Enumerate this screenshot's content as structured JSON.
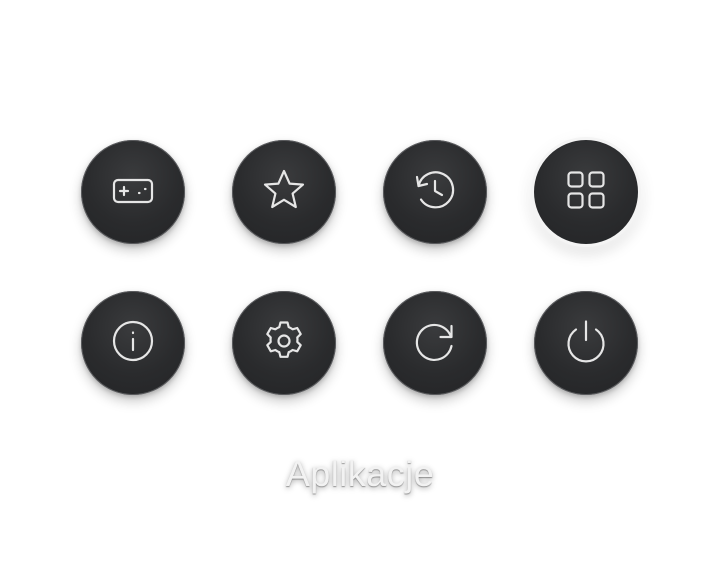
{
  "menu": {
    "items": [
      {
        "id": "games",
        "icon": "gamepad-icon"
      },
      {
        "id": "favorites",
        "icon": "star-icon"
      },
      {
        "id": "history",
        "icon": "history-icon"
      },
      {
        "id": "apps",
        "icon": "apps-grid-icon",
        "selected": true
      },
      {
        "id": "info",
        "icon": "info-icon"
      },
      {
        "id": "settings",
        "icon": "gear-icon"
      },
      {
        "id": "restart",
        "icon": "restart-icon"
      },
      {
        "id": "power",
        "icon": "power-icon"
      }
    ],
    "selected_label": "Aplikacje"
  },
  "colors": {
    "button_bg": "#2a2b2d",
    "icon_stroke": "#e6e6e6",
    "page_bg": "#ffffff",
    "caption_color": "#f2f2f2"
  }
}
